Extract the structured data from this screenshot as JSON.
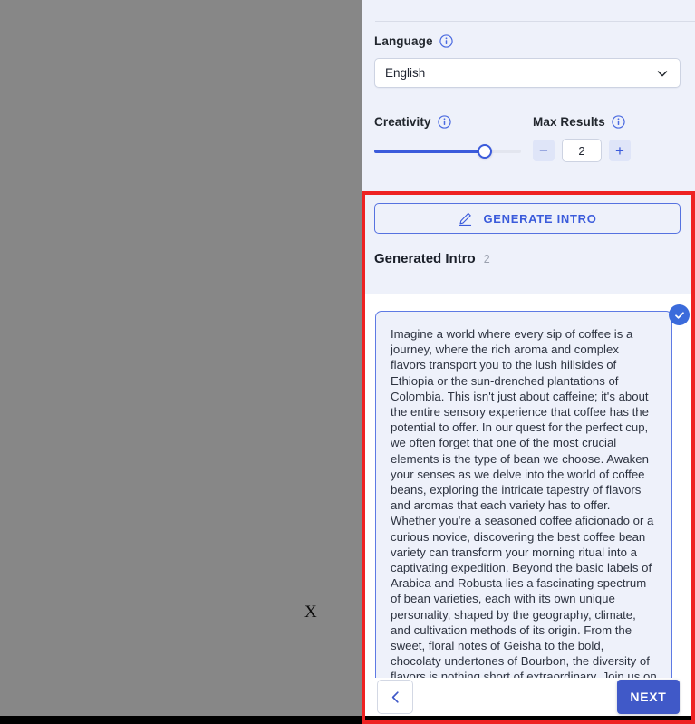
{
  "backdrop": {
    "letter": "X"
  },
  "panel": {
    "language": {
      "label": "Language",
      "info_icon": "info-icon",
      "selected": "English",
      "chevron_icon": "chevron-down-icon"
    },
    "creativity": {
      "label": "Creativity",
      "info_icon": "info-icon",
      "value_percent": 75
    },
    "max_results": {
      "label": "Max Results",
      "info_icon": "info-icon",
      "value": "2",
      "decrement_label": "−",
      "increment_label": "+"
    },
    "generate": {
      "button_label": "GENERATE INTRO",
      "button_icon": "pencil-icon"
    },
    "generated": {
      "heading": "Generated Intro",
      "count": "2",
      "card": {
        "selected_icon": "check-circle-icon",
        "text": "Imagine a world where every sip of coffee is a journey, where the rich aroma and complex flavors transport you to the lush hillsides of Ethiopia or the sun-drenched plantations of Colombia. This isn't just about caffeine; it's about the entire sensory experience that coffee has the potential to offer. In our quest for the perfect cup, we often forget that one of the most crucial elements is the type of bean we choose. Awaken your senses as we delve into the world of coffee beans, exploring the intricate tapestry of flavors and aromas that each variety has to offer. Whether you're a seasoned coffee aficionado or a curious novice, discovering the best coffee bean variety can transform your morning ritual into a captivating expedition. Beyond the basic labels of Arabica and Robusta lies a fascinating spectrum of bean varieties, each with its own unique personality, shaped by the geography, climate, and cultivation methods of its origin. From the sweet, floral notes of Geisha to the bold, chocolaty undertones of Bourbon, the diversity of flavors is nothing short of extraordinary. Join us on this journey as we explore"
      }
    },
    "footer": {
      "back_icon": "chevron-left-icon",
      "next_label": "NEXT"
    }
  },
  "annotation": {
    "color": "#ee2222"
  }
}
